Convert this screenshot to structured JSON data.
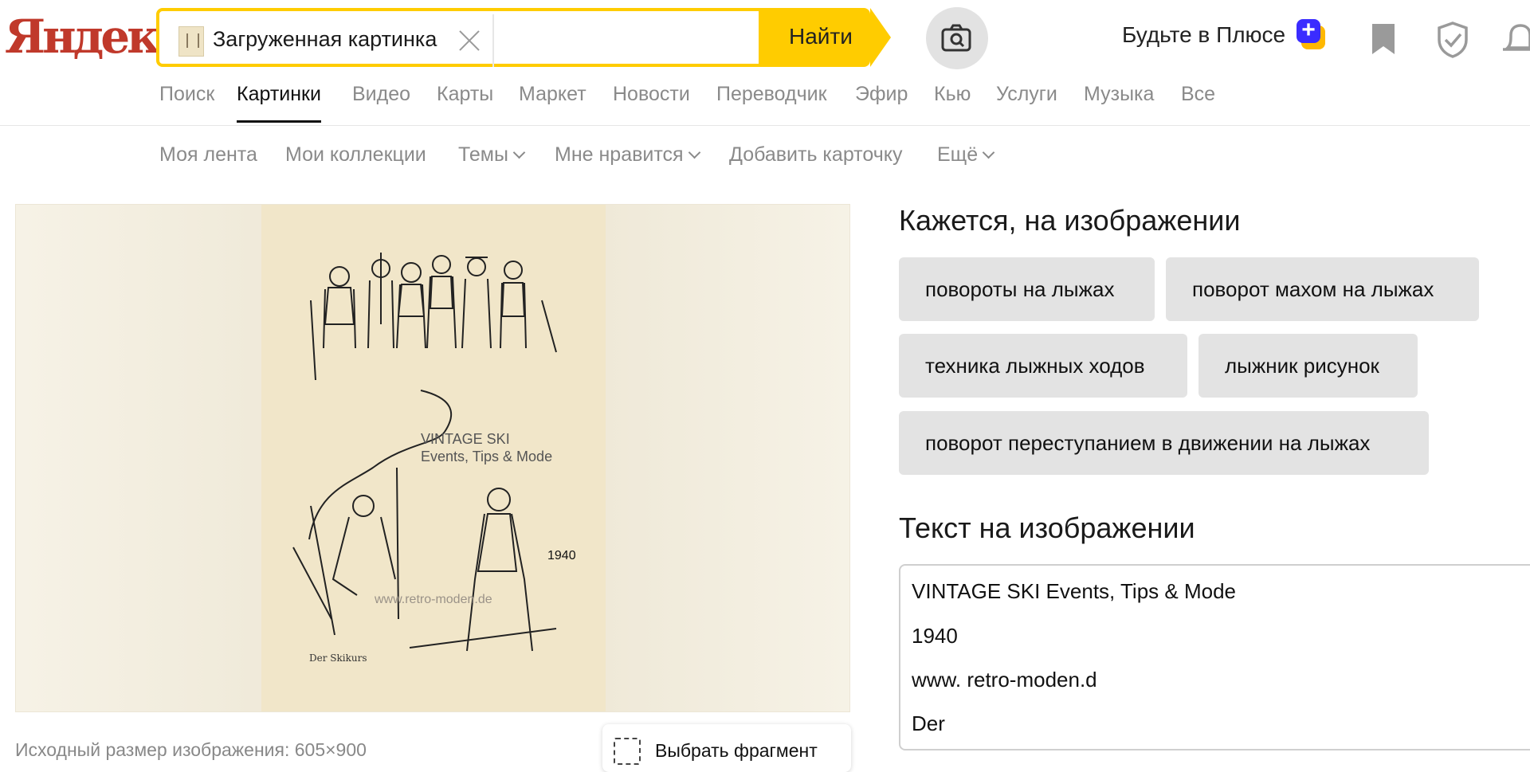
{
  "header": {
    "logo_text": "Яндекс",
    "search": {
      "chip_label": "Загруженная картинка",
      "find_label": "Найти"
    },
    "plus_label": "Будьте в Плюсе",
    "plus_badge": "+"
  },
  "tabs": [
    {
      "label": "Поиск"
    },
    {
      "label": "Картинки",
      "active": true
    },
    {
      "label": "Видео"
    },
    {
      "label": "Карты"
    },
    {
      "label": "Маркет"
    },
    {
      "label": "Новости"
    },
    {
      "label": "Переводчик"
    },
    {
      "label": "Эфир"
    },
    {
      "label": "Кью"
    },
    {
      "label": "Услуги"
    },
    {
      "label": "Музыка"
    },
    {
      "label": "Все"
    }
  ],
  "subnav": [
    {
      "label": "Моя лента",
      "dropdown": false
    },
    {
      "label": "Мои коллекции",
      "dropdown": false
    },
    {
      "label": "Темы",
      "dropdown": true
    },
    {
      "label": "Мне нравится",
      "dropdown": true
    },
    {
      "label": "Добавить карточку",
      "dropdown": false
    },
    {
      "label": "Ещё",
      "dropdown": true
    }
  ],
  "preview": {
    "watermark_title": "VINTAGE SKI",
    "watermark_subtitle": "Events, Tips & Mode",
    "watermark_url": "www.retro-moden.de",
    "year": "1940",
    "caption": "Der Skikurs",
    "original_size": "Исходный размер изображения: 605×900",
    "select_fragment": "Выбрать фрагмент"
  },
  "recognized": {
    "title": "Кажется, на изображении",
    "tags": [
      "повороты на лыжах",
      "поворот махом на лыжах",
      "техника лыжных ходов",
      "лыжник рисунок",
      "поворот переступанием в движении на лыжах"
    ]
  },
  "ocr": {
    "title": "Текст на изображении",
    "lines": [
      "VINTAGE SKI Events, Tips & Mode",
      "1940",
      "www. retro-moden.d",
      "Der"
    ]
  },
  "colors": {
    "accent": "#ffcc00",
    "plus_blue": "#3a2cff",
    "plus_orange": "#ffb800"
  }
}
